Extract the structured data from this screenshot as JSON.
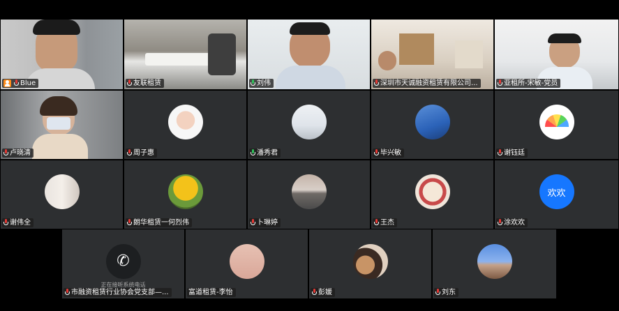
{
  "window": {
    "background": "#000000"
  },
  "participants_row1": [
    {
      "name": "Blue",
      "mic": "muted",
      "self": true
    },
    {
      "name": "友联租赁",
      "mic": "muted"
    },
    {
      "name": "刘伟",
      "mic": "active",
      "speaking": true
    },
    {
      "name": "深圳市天诚融资租赁有限公司...",
      "mic": "muted"
    },
    {
      "name": "亚租所-宋敏-党员",
      "mic": "muted"
    }
  ],
  "participants_row2": [
    {
      "name": "卢晓清",
      "mic": "muted"
    },
    {
      "name": "周子惠",
      "mic": "muted"
    },
    {
      "name": "潘秀君",
      "mic": "active"
    },
    {
      "name": "毕兴敏",
      "mic": "muted"
    },
    {
      "name": "谢钰廷",
      "mic": "muted"
    }
  ],
  "participants_row3": [
    {
      "name": "谢伟全",
      "mic": "muted"
    },
    {
      "name": "朗华租赁一何烈伟",
      "mic": "muted"
    },
    {
      "name": "卜琳婷",
      "mic": "muted"
    },
    {
      "name": "王杰",
      "mic": "muted"
    },
    {
      "name": "涂欢欢",
      "mic": "muted",
      "avatar_text": "欢欢"
    }
  ],
  "participants_row4": [
    {
      "name": "市融资租赁行业协会党支部—...",
      "mic": "muted",
      "status": "正在接听系统电话"
    },
    {
      "name": "富道租赁-李怡",
      "mic": "none"
    },
    {
      "name": "彭媛",
      "mic": "muted"
    },
    {
      "name": "刘东",
      "mic": "muted"
    }
  ]
}
